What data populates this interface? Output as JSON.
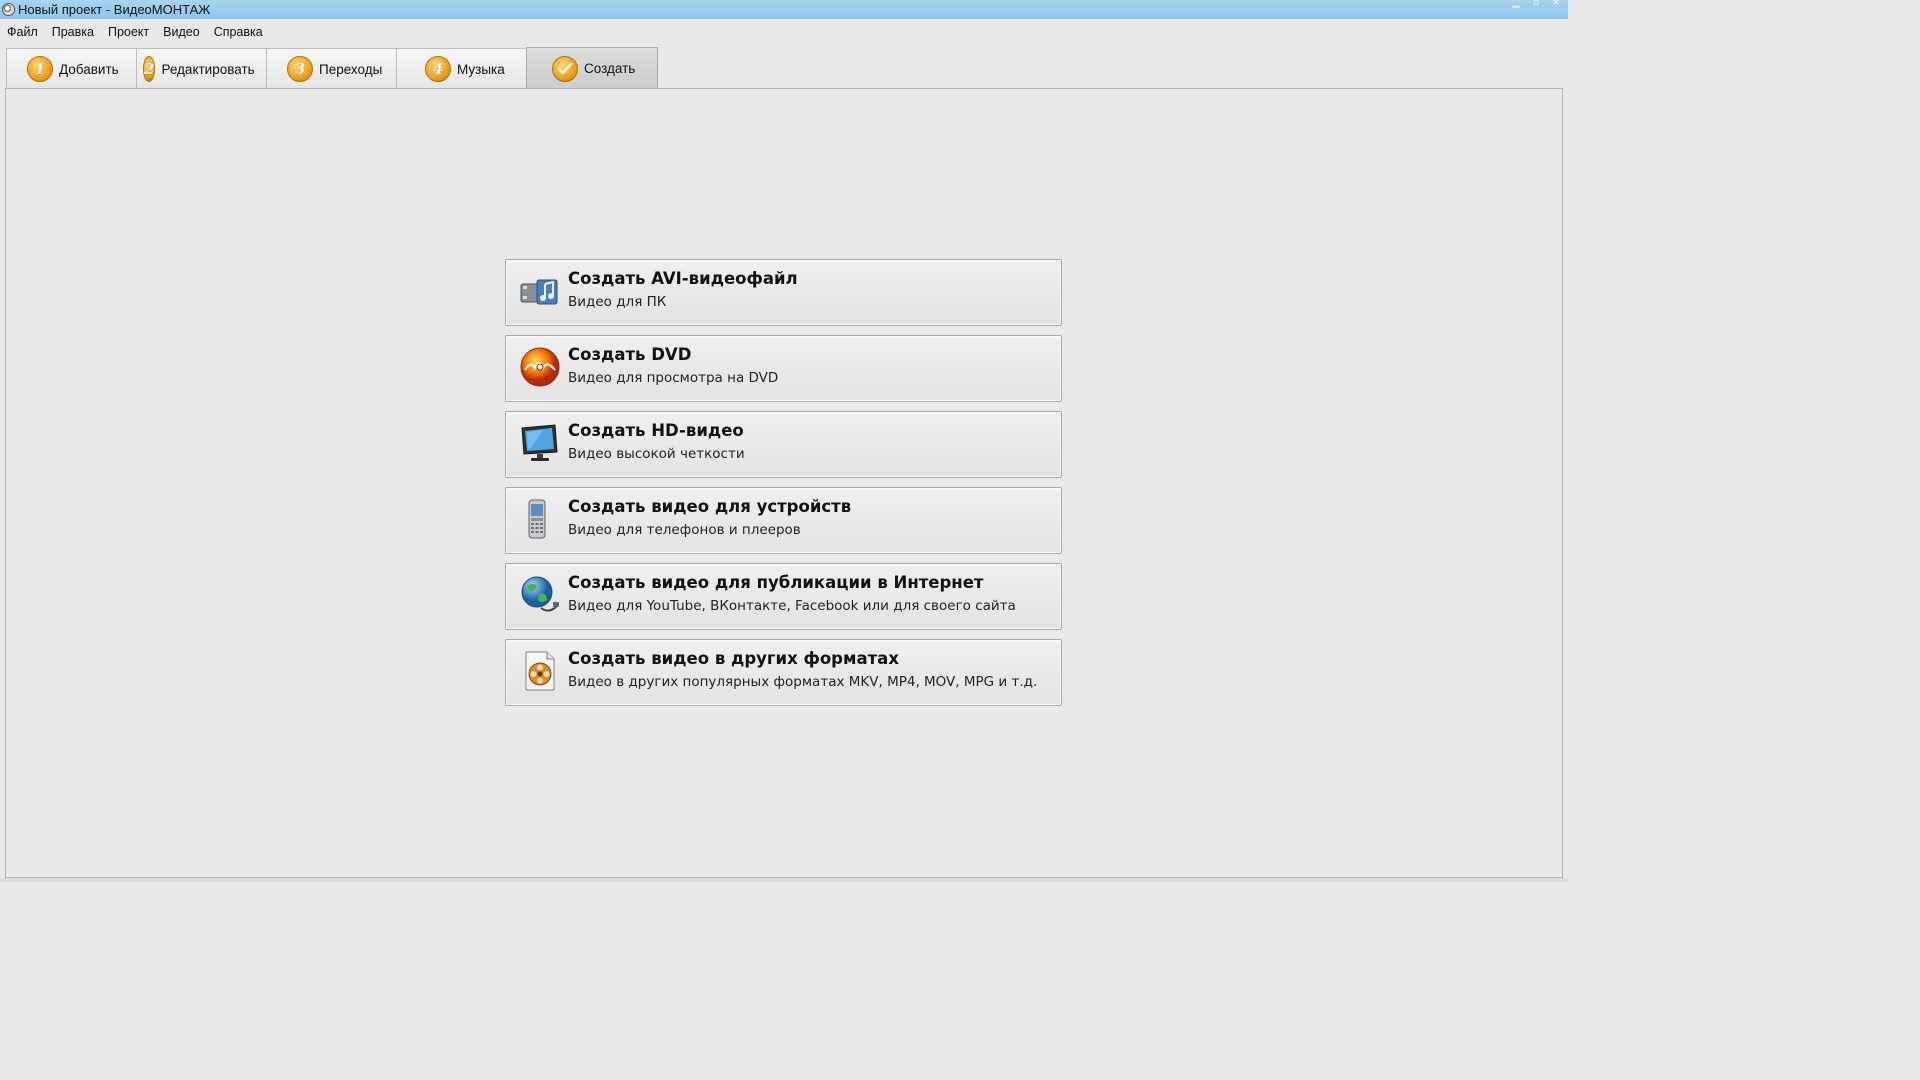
{
  "window": {
    "title": "Новый проект - ВидеоМОНТАЖ",
    "controls": [
      "minimize",
      "maximize",
      "close"
    ]
  },
  "menu": [
    "Файл",
    "Правка",
    "Проект",
    "Видео",
    "Справка"
  ],
  "tabs": [
    {
      "badge": "1",
      "label": "Добавить",
      "icon": "step-1-badge"
    },
    {
      "badge": "2",
      "label": "Редактировать",
      "icon": "step-2-badge"
    },
    {
      "badge": "3",
      "label": "Переходы",
      "icon": "step-3-badge"
    },
    {
      "badge": "4",
      "label": "Музыка",
      "icon": "step-4-badge"
    },
    {
      "badge": "",
      "label": "Создать",
      "icon": "checkmark-badge",
      "active": true
    }
  ],
  "options": [
    {
      "title": "Создать AVI-видеофайл",
      "subtitle": "Видео для ПК",
      "icon": "avi-film-icon"
    },
    {
      "title": "Создать DVD",
      "subtitle": "Видео для просмотра на DVD",
      "icon": "dvd-disc-icon"
    },
    {
      "title": "Создать HD-видео",
      "subtitle": "Видео высокой четкости",
      "icon": "hd-monitor-icon"
    },
    {
      "title": "Создать видео для устройств",
      "subtitle": "Видео для телефонов и плееров",
      "icon": "mobile-phone-icon"
    },
    {
      "title": "Создать видео для публикации в Интернет",
      "subtitle": "Видео для YouTube, ВКонтакте, Facebook или для своего сайта",
      "icon": "globe-internet-icon"
    },
    {
      "title": "Создать видео в других форматах",
      "subtitle": "Видео в других популярных форматах MKV, MP4, MOV, MPG и т.д.",
      "icon": "film-reel-file-icon"
    }
  ],
  "colors": {
    "titlebar": "#9ccbef",
    "background": "#e9e9e9",
    "badge": "#f0a51e"
  }
}
